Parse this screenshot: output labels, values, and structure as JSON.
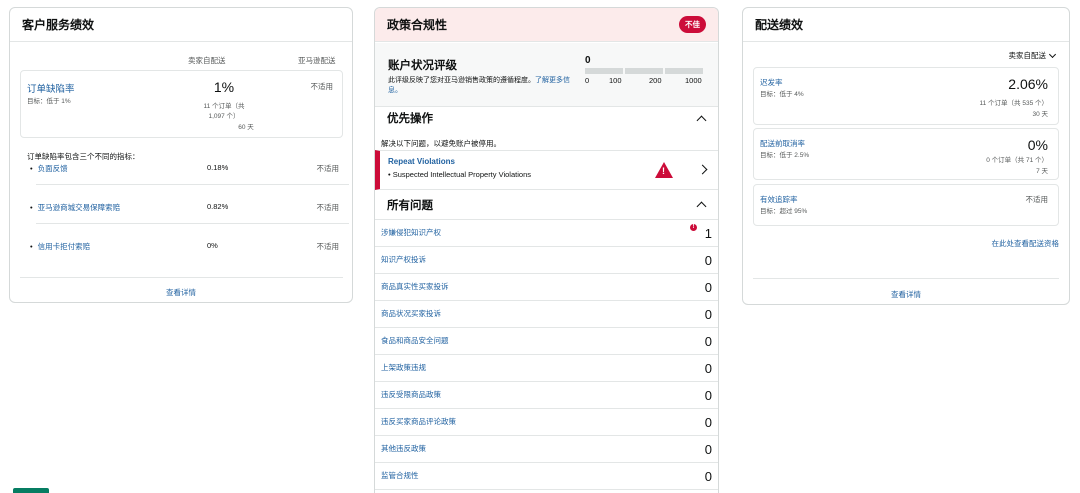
{
  "customer_service": {
    "title": "客户服务绩效",
    "col_seller": "卖家自配送",
    "col_amazon": "亚马逊配送",
    "odr": {
      "name": "订单缺陷率",
      "target": "目标：低于 1%",
      "value": "1%",
      "sub1": "11 个订单（共",
      "sub2": "1,097 个）",
      "sub3": "60 天",
      "amazon_value": "不适用"
    },
    "intro": "订单缺陷率包含三个不同的指标：",
    "rows": [
      {
        "label": "负面反馈",
        "value": "0.18%",
        "amazon": "不适用"
      },
      {
        "label": "亚马逊商城交易保障索赔",
        "value": "0.82%",
        "amazon": "不适用"
      },
      {
        "label": "信用卡拒付索赔",
        "value": "0%",
        "amazon": "不适用"
      }
    ],
    "details_link": "查看详情"
  },
  "policy": {
    "title": "政策合规性",
    "badge": "不佳",
    "ahr_title": "账户状况评级",
    "ahr_desc": "此评级反映了您对亚马逊销售政策的遵循程度。",
    "ahr_link": "了解更多信息。",
    "ahr_score": "0",
    "ticks": [
      "0",
      "100",
      "200",
      "1000"
    ],
    "priority_title": "优先操作",
    "priority_desc": "解决以下问题，以避免账户被停用。",
    "violation_title": "Repeat Violations",
    "violation_sub": "• Suspected Intellectual Property Violations",
    "all_issues_title": "所有问题",
    "issues": [
      {
        "label": "涉嫌侵犯知识产权",
        "count": "1",
        "alert": "!"
      },
      {
        "label": "知识产权投诉",
        "count": "0"
      },
      {
        "label": "商品真实性买家投诉",
        "count": "0"
      },
      {
        "label": "商品状况买家投诉",
        "count": "0"
      },
      {
        "label": "食品和商品安全问题",
        "count": "0"
      },
      {
        "label": "上架政策违规",
        "count": "0"
      },
      {
        "label": "违反受限商品政策",
        "count": "0"
      },
      {
        "label": "违反买家商品评论政策",
        "count": "0"
      },
      {
        "label": "其他违反政策",
        "count": "0"
      },
      {
        "label": "监管合规性",
        "count": "0"
      }
    ]
  },
  "shipping": {
    "title": "配送绩效",
    "filter": "卖家自配送",
    "late_rate": {
      "name": "迟发率",
      "target": "目标：低于 4%",
      "value": "2.06%",
      "sub1": "11 个订单（共 535 个）",
      "sub2": "30 天"
    },
    "cancel_rate": {
      "name": "配送前取消率",
      "target": "目标：低于 2.5%",
      "value": "0%",
      "sub1": "0 个订单（共 71 个）",
      "sub2": "7 天"
    },
    "vtr": {
      "name": "有效追踪率",
      "target": "目标：超过 95%",
      "value": "不适用"
    },
    "link": "在此处查看配送资格",
    "details_link": "查看详情"
  }
}
